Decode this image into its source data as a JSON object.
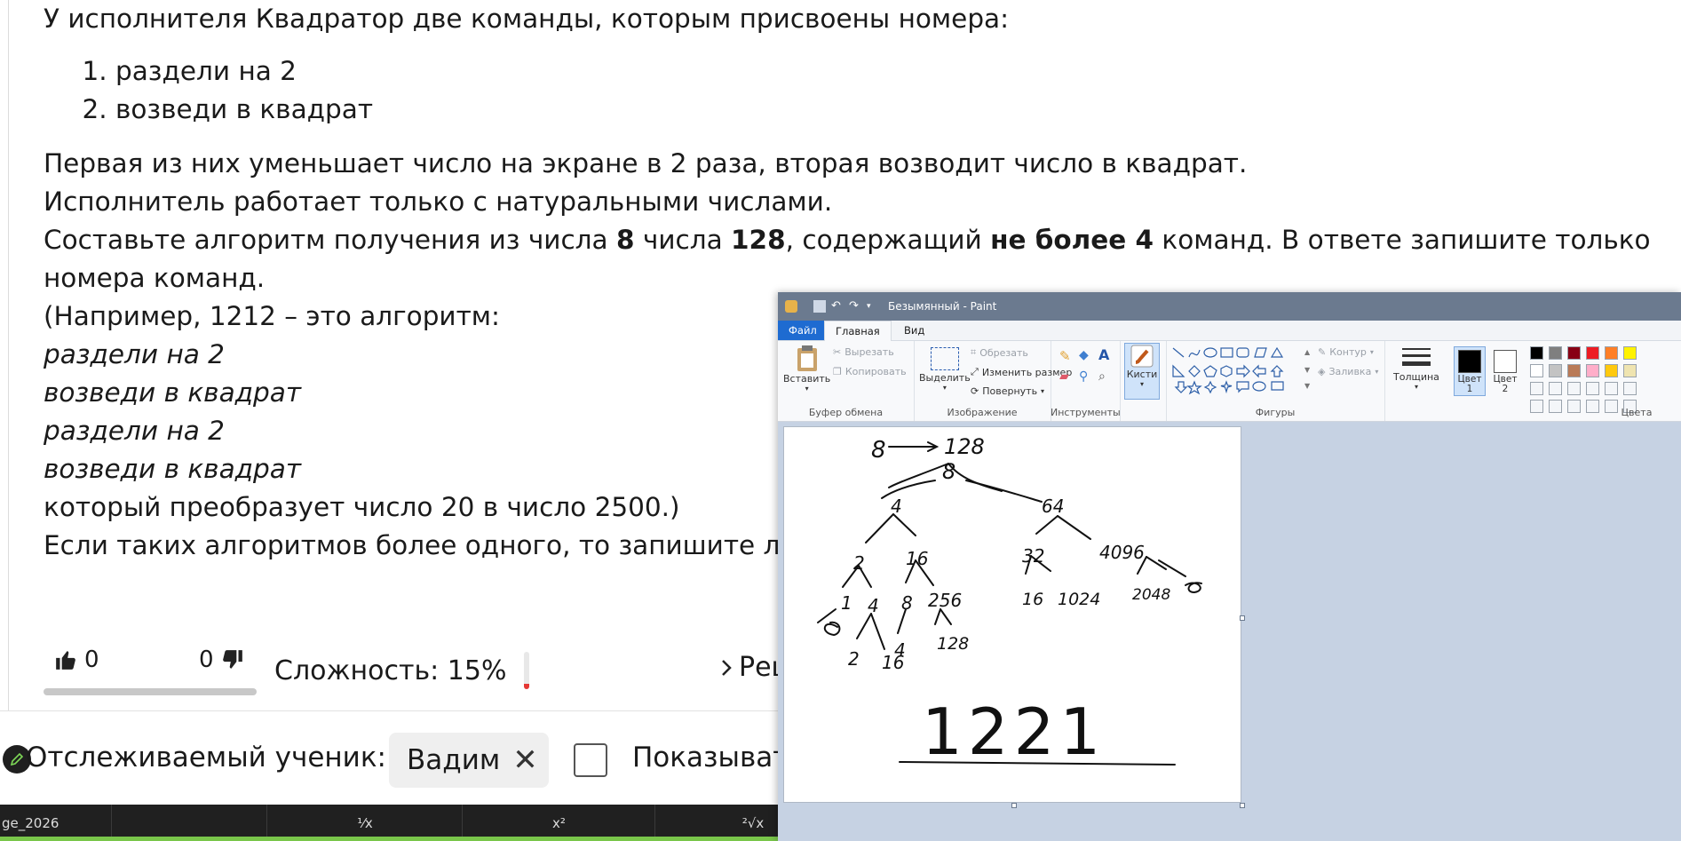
{
  "task": {
    "intro": "У исполнителя Квадратор две команды, которым присвоены номера:",
    "commands": [
      "раздели на 2",
      "возведи в квадрат"
    ],
    "line1": "Первая из них уменьшает число на экране в 2 раза, вторая возводит число в квадрат.",
    "line2": "Исполнитель работает только с натуральными числами.",
    "line3_a": "Составьте алгоритм получения из числа ",
    "line3_b": "8",
    "line3_c": " числа ",
    "line3_d": "128",
    "line3_e": ", содержащий ",
    "line3_f": "не более 4",
    "line3_g": " команд. В ответе запишите только",
    "line4": "номера команд.",
    "line5": "(Например, 1212 – это алгоритм:",
    "example": [
      "раздели на 2",
      "возведи в квадрат",
      "раздели на 2",
      "возведи в квадрат"
    ],
    "line6": "который преобразует число 20 в число 2500.)",
    "line7": "Если таких алгоритмов более одного, то запишите любой из них."
  },
  "votes": {
    "up": "0",
    "down": "0"
  },
  "difficulty": {
    "label": "Сложность: 15%",
    "level": 0.15
  },
  "solution_link": "Решение",
  "tracker": {
    "label": "Отслеживаемый ученик:",
    "student": "Вадим",
    "show_label": "Показывать"
  },
  "taskbar": {
    "name": "ge_2026",
    "k1": "¹⁄x",
    "k2": "x²",
    "k3": "²√x"
  },
  "paint": {
    "title": "Безымянный - Paint",
    "tabs": {
      "file": "Файл",
      "home": "Главная",
      "view": "Вид"
    },
    "clipboard": {
      "paste": "Вставить",
      "cut": "Вырезать",
      "copy": "Копировать",
      "group": "Буфер обмена"
    },
    "image": {
      "select": "Выделить",
      "crop": "Обрезать",
      "resize": "Изменить размер",
      "rotate": "Повернуть",
      "group": "Изображение"
    },
    "tools": {
      "group": "Инструменты"
    },
    "brushes": "Кисти",
    "shapes": {
      "outline": "Контур",
      "fill": "Заливка",
      "group": "Фигуры"
    },
    "size": "Толщина",
    "color1": "Цвет 1",
    "color2": "Цвет 2",
    "colors_group": "Цвета",
    "palette": [
      "#000000",
      "#7f7f7f",
      "#880015",
      "#ed1c24",
      "#ff7f27",
      "#fff200",
      "#ffffff",
      "#c3c3c3",
      "#b97a57",
      "#ffaec9",
      "#ffc90e",
      "#efe4b0"
    ],
    "canvas": {
      "n8": "8",
      "n128": "128",
      "root": "8",
      "a4": "4",
      "a64": "64",
      "b2": "2",
      "b16": "16",
      "b32": "32",
      "b4096": "4096",
      "c1": "1",
      "c4": "4",
      "c8": "8",
      "c256": "256",
      "c16": "16",
      "c1024": "1024",
      "c2048": "2048",
      "d2": "2",
      "d16": "16",
      "d4": "4",
      "d128": "128",
      "answer": "1221"
    }
  }
}
